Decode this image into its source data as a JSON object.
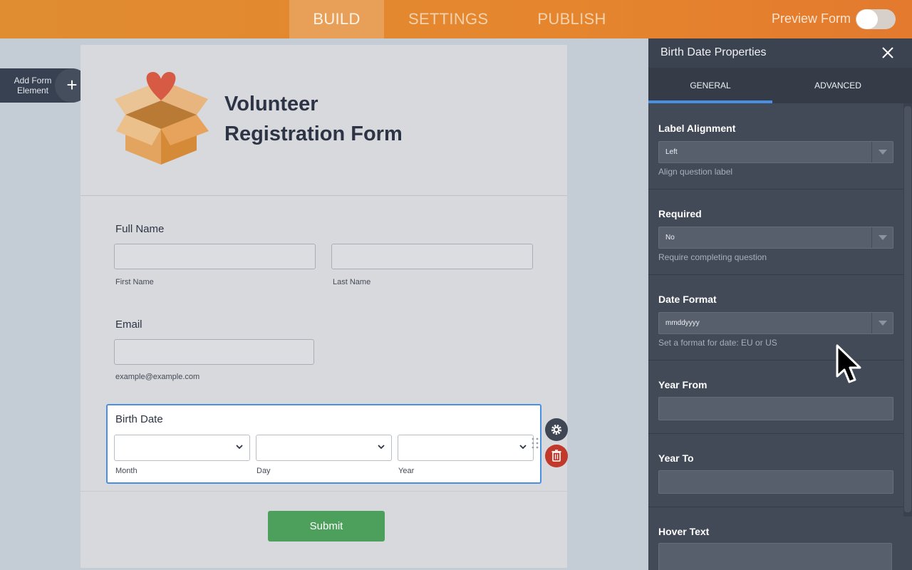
{
  "topbar": {
    "tabs": [
      {
        "label": "BUILD",
        "active": true
      },
      {
        "label": "SETTINGS",
        "active": false
      },
      {
        "label": "PUBLISH",
        "active": false
      }
    ],
    "preview_label": "Preview Form",
    "preview_enabled": false
  },
  "add_element": {
    "label": "Add Form Element"
  },
  "form": {
    "title_line1": "Volunteer",
    "title_line2": "Registration Form",
    "full_name": {
      "label": "Full Name",
      "first_sub": "First Name",
      "last_sub": "Last Name"
    },
    "email": {
      "label": "Email",
      "sub": "example@example.com"
    },
    "birth_date": {
      "label": "Birth Date",
      "month_sub": "Month",
      "day_sub": "Day",
      "year_sub": "Year"
    },
    "submit_label": "Submit"
  },
  "panel": {
    "title": "Birth Date Properties",
    "tabs": [
      {
        "label": "GENERAL",
        "active": true
      },
      {
        "label": "ADVANCED",
        "active": false
      }
    ],
    "label_alignment": {
      "label": "Label Alignment",
      "value": "Left",
      "help": "Align question label"
    },
    "required": {
      "label": "Required",
      "value": "No",
      "help": "Require completing question"
    },
    "date_format": {
      "label": "Date Format",
      "value": "mmddyyyy",
      "help": "Set a format for date: EU or US"
    },
    "year_from": {
      "label": "Year From",
      "value": ""
    },
    "year_to": {
      "label": "Year To",
      "value": ""
    },
    "hover_text": {
      "label": "Hover Text",
      "value": ""
    }
  },
  "colors": {
    "topbar": "#e5862e",
    "accent": "#4a90e2",
    "submit": "#4da05c",
    "delete": "#c0392b",
    "panel": "#434a57"
  }
}
